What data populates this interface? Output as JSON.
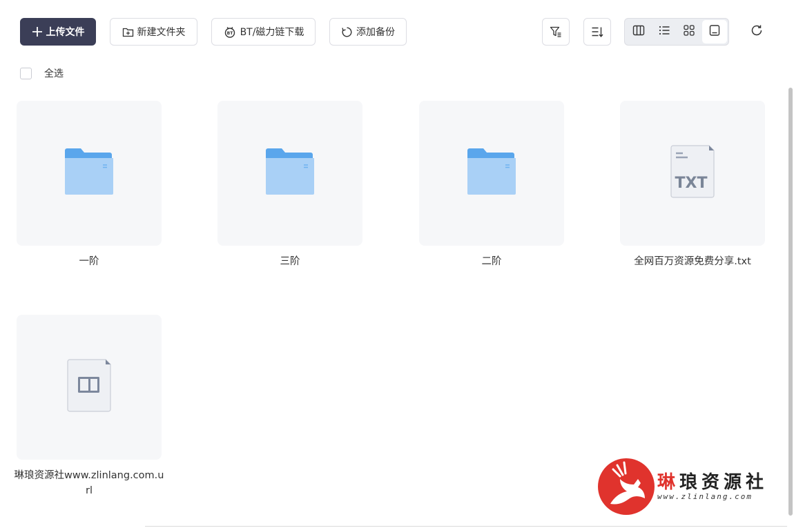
{
  "toolbar": {
    "upload_label": "上传文件",
    "new_folder_label": "新建文件夹",
    "bt_label": "BT/磁力链下载",
    "backup_label": "添加备份"
  },
  "select_all_label": "全选",
  "view_modes": [
    "columns-view",
    "list-view",
    "grid-view",
    "thumbnail-view"
  ],
  "active_view": "thumbnail-view",
  "files": [
    {
      "name": "一阶",
      "type": "folder"
    },
    {
      "name": "三阶",
      "type": "folder"
    },
    {
      "name": "二阶",
      "type": "folder"
    },
    {
      "name": "全网百万资源免费分享.txt",
      "type": "txt",
      "badge": "TXT"
    },
    {
      "name": "琳琅资源社www.zlinlang.com.url",
      "type": "url"
    }
  ],
  "watermark": {
    "title_red": "琳",
    "title_rest": "琅资源社",
    "url": "www.zlinlang.com"
  },
  "colors": {
    "primary_button": "#3b3e57",
    "folder_blue": "#6fb2f0",
    "watermark_red": "#e0332d"
  }
}
